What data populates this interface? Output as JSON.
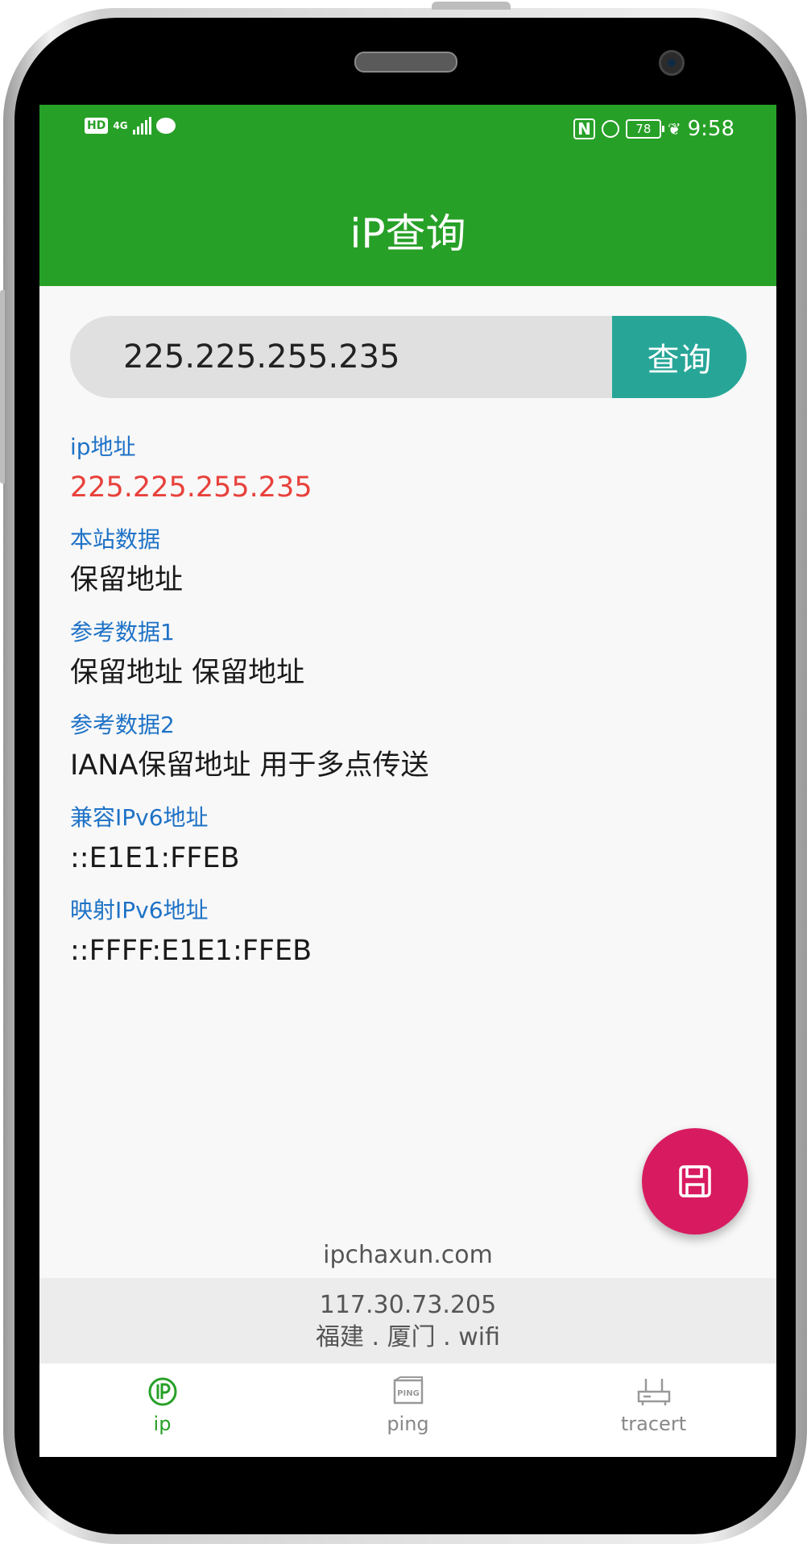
{
  "status_bar": {
    "network_badge": "HD",
    "signal_type": "4G",
    "battery": "78",
    "time": "9:58"
  },
  "app": {
    "title": "iP查询"
  },
  "search": {
    "value": "225.225.255.235",
    "button_label": "查询"
  },
  "results": [
    {
      "label": "ip地址",
      "value": "225.225.255.235",
      "highlight": true
    },
    {
      "label": "本站数据",
      "value": "保留地址"
    },
    {
      "label": "参考数据1",
      "value": "保留地址 保留地址"
    },
    {
      "label": "参考数据2",
      "value": "IANA保留地址 用于多点传送"
    },
    {
      "label": "兼容IPv6地址",
      "value": "::E1E1:FFEB"
    },
    {
      "label": "映射IPv6地址",
      "value": "::FFFF:E1E1:FFEB"
    }
  ],
  "footer": {
    "site": "ipchaxun.com",
    "client_ip": "117.30.73.205",
    "client_location": "福建 . 厦门 . wifi"
  },
  "bottom_nav": [
    {
      "label": "ip",
      "icon": "ip-icon",
      "active": true
    },
    {
      "label": "ping",
      "icon": "ping-icon",
      "icon_text": "PING",
      "active": false
    },
    {
      "label": "tracert",
      "icon": "router-icon",
      "active": false
    }
  ],
  "fab": {
    "icon": "save-icon"
  },
  "colors": {
    "primary": "#27a027",
    "search_button": "#27a698",
    "fab": "#d81b60",
    "label_blue": "#1e72c6",
    "ip_red": "#e8413c"
  }
}
